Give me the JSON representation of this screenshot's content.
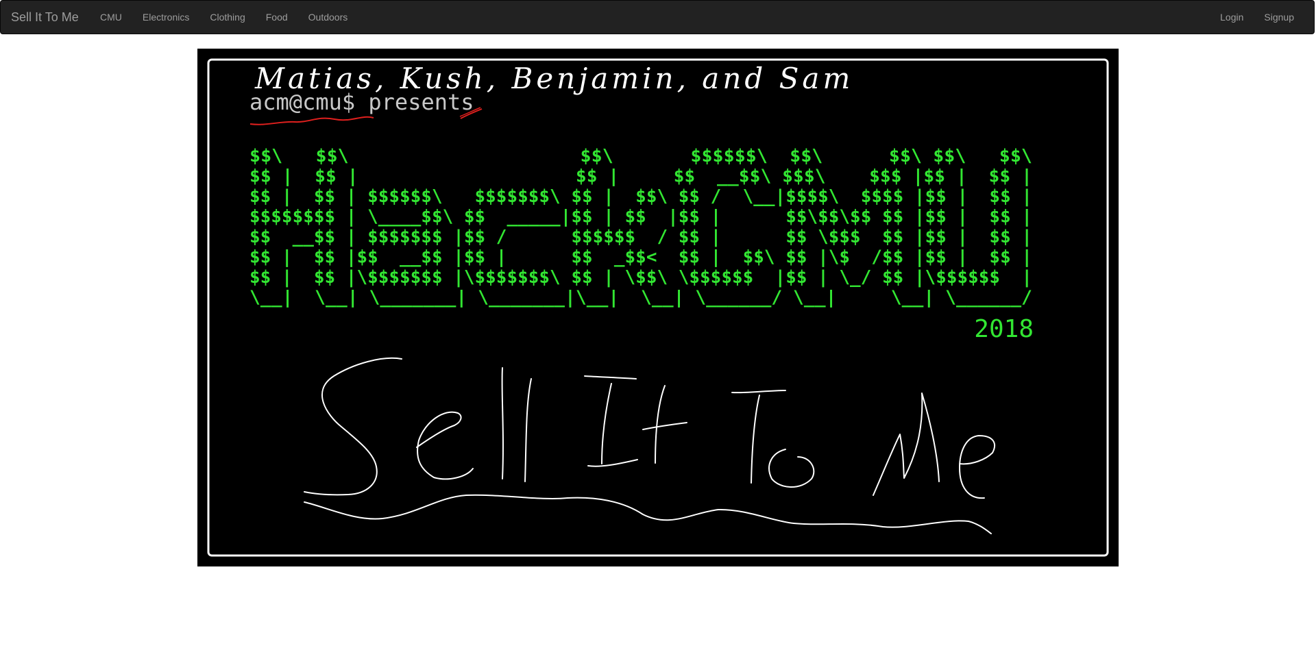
{
  "nav": {
    "brand": "Sell It To Me",
    "left_items": [
      "CMU",
      "Electronics",
      "Clothing",
      "Food",
      "Outdoors"
    ],
    "right_items": [
      "Login",
      "Signup"
    ]
  },
  "banner": {
    "authors_handwritten": "Matias, Kush, Benjamin, and Sam",
    "prompt_text": "acm@cmu$ presents",
    "ascii_art_lines": [
      "$$\\   $$\\                     $$\\       $$$$$$\\  $$\\      $$\\ $$\\   $$\\",
      "$$ |  $$ |                    $$ |     $$  __$$\\ $$$\\    $$$ |$$ |  $$ |",
      "$$ |  $$ | $$$$$$\\   $$$$$$$\\ $$ |  $$\\ $$ /  \\__|$$$$\\  $$$$ |$$ |  $$ |",
      "$$$$$$$$ | \\____$$\\ $$  _____|$$ | $$  |$$ |      $$\\$$\\$$ $$ |$$ |  $$ |",
      "$$  __$$ | $$$$$$$ |$$ /      $$$$$$  / $$ |      $$ \\$$$  $$ |$$ |  $$ |",
      "$$ |  $$ |$$  __$$ |$$ |      $$  _$$<  $$ |  $$\\ $$ |\\$  /$$ |$$ |  $$ |",
      "$$ |  $$ |\\$$$$$$$ |\\$$$$$$$\\ $$ | \\$$\\ \\$$$$$$  |$$ | \\_/ $$ |\\$$$$$$  |",
      "\\__|  \\__| \\_______| \\_______|\\__|  \\__| \\______/ \\__|     \\__| \\______/"
    ],
    "year": "2018",
    "title_handwritten": "Sell It To Me",
    "colors": {
      "background": "#000000",
      "frame": "#ffffff",
      "ascii": "#32e632",
      "prompt": "#c8c8c8",
      "strike": "#e0201e"
    }
  }
}
